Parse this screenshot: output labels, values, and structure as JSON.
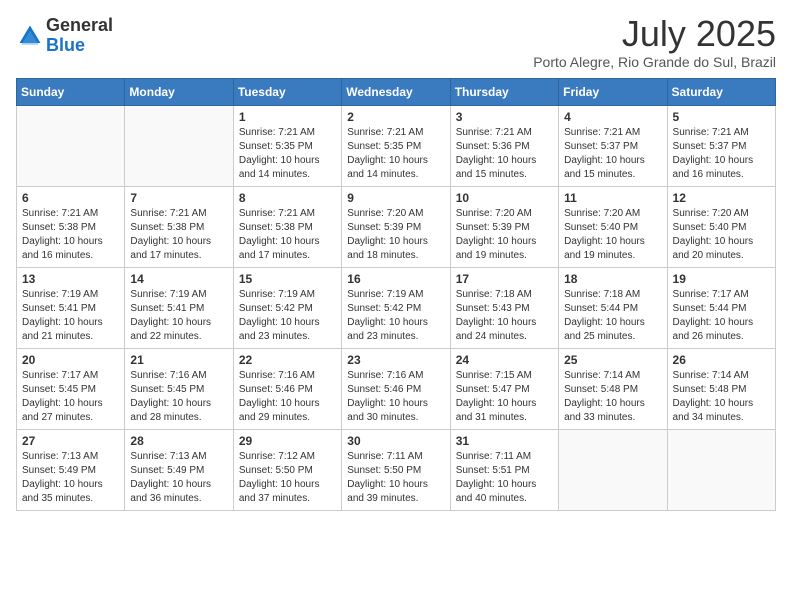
{
  "logo": {
    "general": "General",
    "blue": "Blue"
  },
  "title": "July 2025",
  "location": "Porto Alegre, Rio Grande do Sul, Brazil",
  "weekdays": [
    "Sunday",
    "Monday",
    "Tuesday",
    "Wednesday",
    "Thursday",
    "Friday",
    "Saturday"
  ],
  "weeks": [
    [
      {
        "day": null
      },
      {
        "day": null
      },
      {
        "day": "1",
        "sunrise": "7:21 AM",
        "sunset": "5:35 PM",
        "daylight": "10 hours and 14 minutes."
      },
      {
        "day": "2",
        "sunrise": "7:21 AM",
        "sunset": "5:35 PM",
        "daylight": "10 hours and 14 minutes."
      },
      {
        "day": "3",
        "sunrise": "7:21 AM",
        "sunset": "5:36 PM",
        "daylight": "10 hours and 15 minutes."
      },
      {
        "day": "4",
        "sunrise": "7:21 AM",
        "sunset": "5:37 PM",
        "daylight": "10 hours and 15 minutes."
      },
      {
        "day": "5",
        "sunrise": "7:21 AM",
        "sunset": "5:37 PM",
        "daylight": "10 hours and 16 minutes."
      }
    ],
    [
      {
        "day": "6",
        "sunrise": "7:21 AM",
        "sunset": "5:38 PM",
        "daylight": "10 hours and 16 minutes."
      },
      {
        "day": "7",
        "sunrise": "7:21 AM",
        "sunset": "5:38 PM",
        "daylight": "10 hours and 17 minutes."
      },
      {
        "day": "8",
        "sunrise": "7:21 AM",
        "sunset": "5:38 PM",
        "daylight": "10 hours and 17 minutes."
      },
      {
        "day": "9",
        "sunrise": "7:20 AM",
        "sunset": "5:39 PM",
        "daylight": "10 hours and 18 minutes."
      },
      {
        "day": "10",
        "sunrise": "7:20 AM",
        "sunset": "5:39 PM",
        "daylight": "10 hours and 19 minutes."
      },
      {
        "day": "11",
        "sunrise": "7:20 AM",
        "sunset": "5:40 PM",
        "daylight": "10 hours and 19 minutes."
      },
      {
        "day": "12",
        "sunrise": "7:20 AM",
        "sunset": "5:40 PM",
        "daylight": "10 hours and 20 minutes."
      }
    ],
    [
      {
        "day": "13",
        "sunrise": "7:19 AM",
        "sunset": "5:41 PM",
        "daylight": "10 hours and 21 minutes."
      },
      {
        "day": "14",
        "sunrise": "7:19 AM",
        "sunset": "5:41 PM",
        "daylight": "10 hours and 22 minutes."
      },
      {
        "day": "15",
        "sunrise": "7:19 AM",
        "sunset": "5:42 PM",
        "daylight": "10 hours and 23 minutes."
      },
      {
        "day": "16",
        "sunrise": "7:19 AM",
        "sunset": "5:42 PM",
        "daylight": "10 hours and 23 minutes."
      },
      {
        "day": "17",
        "sunrise": "7:18 AM",
        "sunset": "5:43 PM",
        "daylight": "10 hours and 24 minutes."
      },
      {
        "day": "18",
        "sunrise": "7:18 AM",
        "sunset": "5:44 PM",
        "daylight": "10 hours and 25 minutes."
      },
      {
        "day": "19",
        "sunrise": "7:17 AM",
        "sunset": "5:44 PM",
        "daylight": "10 hours and 26 minutes."
      }
    ],
    [
      {
        "day": "20",
        "sunrise": "7:17 AM",
        "sunset": "5:45 PM",
        "daylight": "10 hours and 27 minutes."
      },
      {
        "day": "21",
        "sunrise": "7:16 AM",
        "sunset": "5:45 PM",
        "daylight": "10 hours and 28 minutes."
      },
      {
        "day": "22",
        "sunrise": "7:16 AM",
        "sunset": "5:46 PM",
        "daylight": "10 hours and 29 minutes."
      },
      {
        "day": "23",
        "sunrise": "7:16 AM",
        "sunset": "5:46 PM",
        "daylight": "10 hours and 30 minutes."
      },
      {
        "day": "24",
        "sunrise": "7:15 AM",
        "sunset": "5:47 PM",
        "daylight": "10 hours and 31 minutes."
      },
      {
        "day": "25",
        "sunrise": "7:14 AM",
        "sunset": "5:48 PM",
        "daylight": "10 hours and 33 minutes."
      },
      {
        "day": "26",
        "sunrise": "7:14 AM",
        "sunset": "5:48 PM",
        "daylight": "10 hours and 34 minutes."
      }
    ],
    [
      {
        "day": "27",
        "sunrise": "7:13 AM",
        "sunset": "5:49 PM",
        "daylight": "10 hours and 35 minutes."
      },
      {
        "day": "28",
        "sunrise": "7:13 AM",
        "sunset": "5:49 PM",
        "daylight": "10 hours and 36 minutes."
      },
      {
        "day": "29",
        "sunrise": "7:12 AM",
        "sunset": "5:50 PM",
        "daylight": "10 hours and 37 minutes."
      },
      {
        "day": "30",
        "sunrise": "7:11 AM",
        "sunset": "5:50 PM",
        "daylight": "10 hours and 39 minutes."
      },
      {
        "day": "31",
        "sunrise": "7:11 AM",
        "sunset": "5:51 PM",
        "daylight": "10 hours and 40 minutes."
      },
      {
        "day": null
      },
      {
        "day": null
      }
    ]
  ],
  "labels": {
    "sunrise": "Sunrise:",
    "sunset": "Sunset:",
    "daylight": "Daylight:"
  }
}
